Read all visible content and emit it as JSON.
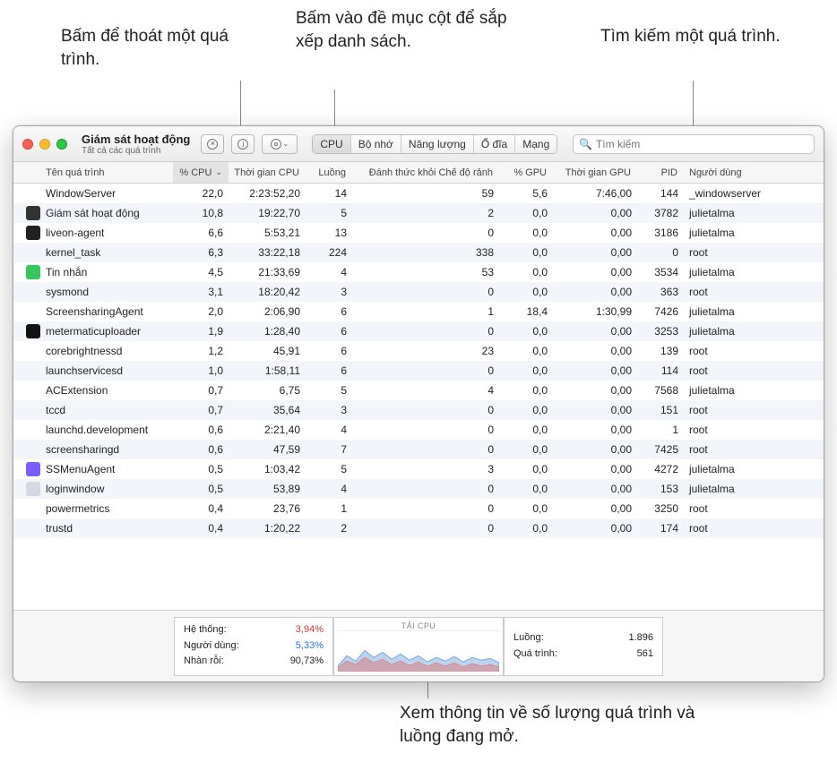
{
  "callouts": {
    "quit": "Bấm để thoát một quá trình.",
    "sort": "Bấm vào đề mục cột để sắp xếp danh sách.",
    "search": "Tìm kiếm một quá trình.",
    "footer": "Xem thông tin về số lượng quá trình và luồng đang mở."
  },
  "window": {
    "title": "Giám sát hoạt động",
    "subtitle": "Tất cả các quá trình"
  },
  "tabs": [
    "CPU",
    "Bộ nhớ",
    "Năng lượng",
    "Ổ đĩa",
    "Mạng"
  ],
  "search_placeholder": "Tìm kiếm",
  "columns": {
    "name": "Tên quá trình",
    "cpu": "% CPU",
    "cputime": "Thời gian CPU",
    "threads": "Luồng",
    "idlewake": "Đánh thức khỏi Chế độ rảnh",
    "gpu": "% GPU",
    "gputime": "Thời gian GPU",
    "pid": "PID",
    "user": "Người dùng"
  },
  "rows": [
    {
      "icon": "",
      "name": "WindowServer",
      "cpu": "22,0",
      "cputime": "2:23:52,20",
      "threads": "14",
      "idle": "59",
      "gpu": "5,6",
      "gputime": "7:46,00",
      "pid": "144",
      "user": "_windowserver"
    },
    {
      "icon": "#333",
      "name": "Giám sát hoạt động",
      "cpu": "10,8",
      "cputime": "19:22,70",
      "threads": "5",
      "idle": "2",
      "gpu": "0,0",
      "gputime": "0,00",
      "pid": "3782",
      "user": "julietalma"
    },
    {
      "icon": "#222",
      "name": "liveon-agent",
      "cpu": "6,6",
      "cputime": "5:53,21",
      "threads": "13",
      "idle": "0",
      "gpu": "0,0",
      "gputime": "0,00",
      "pid": "3186",
      "user": "julietalma"
    },
    {
      "icon": "",
      "name": "kernel_task",
      "cpu": "6,3",
      "cputime": "33:22,18",
      "threads": "224",
      "idle": "338",
      "gpu": "0,0",
      "gputime": "0,00",
      "pid": "0",
      "user": "root"
    },
    {
      "icon": "#34c759",
      "name": "Tin nhắn",
      "cpu": "4,5",
      "cputime": "21:33,69",
      "threads": "4",
      "idle": "53",
      "gpu": "0,0",
      "gputime": "0,00",
      "pid": "3534",
      "user": "julietalma"
    },
    {
      "icon": "",
      "name": "sysmond",
      "cpu": "3,1",
      "cputime": "18:20,42",
      "threads": "3",
      "idle": "0",
      "gpu": "0,0",
      "gputime": "0,00",
      "pid": "363",
      "user": "root"
    },
    {
      "icon": "",
      "name": "ScreensharingAgent",
      "cpu": "2,0",
      "cputime": "2:06,90",
      "threads": "6",
      "idle": "1",
      "gpu": "18,4",
      "gputime": "1:30,99",
      "pid": "7426",
      "user": "julietalma"
    },
    {
      "icon": "#111",
      "name": "metermaticuploader",
      "cpu": "1,9",
      "cputime": "1:28,40",
      "threads": "6",
      "idle": "0",
      "gpu": "0,0",
      "gputime": "0,00",
      "pid": "3253",
      "user": "julietalma"
    },
    {
      "icon": "",
      "name": "corebrightnessd",
      "cpu": "1,2",
      "cputime": "45,91",
      "threads": "6",
      "idle": "23",
      "gpu": "0,0",
      "gputime": "0,00",
      "pid": "139",
      "user": "root"
    },
    {
      "icon": "",
      "name": "launchservicesd",
      "cpu": "1,0",
      "cputime": "1:58,11",
      "threads": "6",
      "idle": "0",
      "gpu": "0,0",
      "gputime": "0,00",
      "pid": "114",
      "user": "root"
    },
    {
      "icon": "",
      "name": "ACExtension",
      "cpu": "0,7",
      "cputime": "6,75",
      "threads": "5",
      "idle": "4",
      "gpu": "0,0",
      "gputime": "0,00",
      "pid": "7568",
      "user": "julietalma"
    },
    {
      "icon": "",
      "name": "tccd",
      "cpu": "0,7",
      "cputime": "35,64",
      "threads": "3",
      "idle": "0",
      "gpu": "0,0",
      "gputime": "0,00",
      "pid": "151",
      "user": "root"
    },
    {
      "icon": "",
      "name": "launchd.development",
      "cpu": "0,6",
      "cputime": "2:21,40",
      "threads": "4",
      "idle": "0",
      "gpu": "0,0",
      "gputime": "0,00",
      "pid": "1",
      "user": "root"
    },
    {
      "icon": "",
      "name": "screensharingd",
      "cpu": "0,6",
      "cputime": "47,59",
      "threads": "7",
      "idle": "0",
      "gpu": "0,0",
      "gputime": "0,00",
      "pid": "7425",
      "user": "root"
    },
    {
      "icon": "#7b5cff",
      "name": "SSMenuAgent",
      "cpu": "0,5",
      "cputime": "1:03,42",
      "threads": "5",
      "idle": "3",
      "gpu": "0,0",
      "gputime": "0,00",
      "pid": "4272",
      "user": "julietalma"
    },
    {
      "icon": "#d8d8e4",
      "name": "loginwindow",
      "cpu": "0,5",
      "cputime": "53,89",
      "threads": "4",
      "idle": "0",
      "gpu": "0,0",
      "gputime": "0,00",
      "pid": "153",
      "user": "julietalma"
    },
    {
      "icon": "",
      "name": "powermetrics",
      "cpu": "0,4",
      "cputime": "23,76",
      "threads": "1",
      "idle": "0",
      "gpu": "0,0",
      "gputime": "0,00",
      "pid": "3250",
      "user": "root"
    },
    {
      "icon": "",
      "name": "trustd",
      "cpu": "0,4",
      "cputime": "1:20,22",
      "threads": "2",
      "idle": "0",
      "gpu": "0,0",
      "gputime": "0,00",
      "pid": "174",
      "user": "root"
    }
  ],
  "footer": {
    "left": {
      "system_label": "Hệ thống:",
      "system_value": "3,94%",
      "user_label": "Người dùng:",
      "user_value": "5,33%",
      "idle_label": "Nhàn rỗi:",
      "idle_value": "90,73%"
    },
    "graph_title": "TẢI CPU",
    "right": {
      "threads_label": "Luồng:",
      "threads_value": "1.896",
      "proc_label": "Quá trình:",
      "proc_value": "561"
    }
  }
}
